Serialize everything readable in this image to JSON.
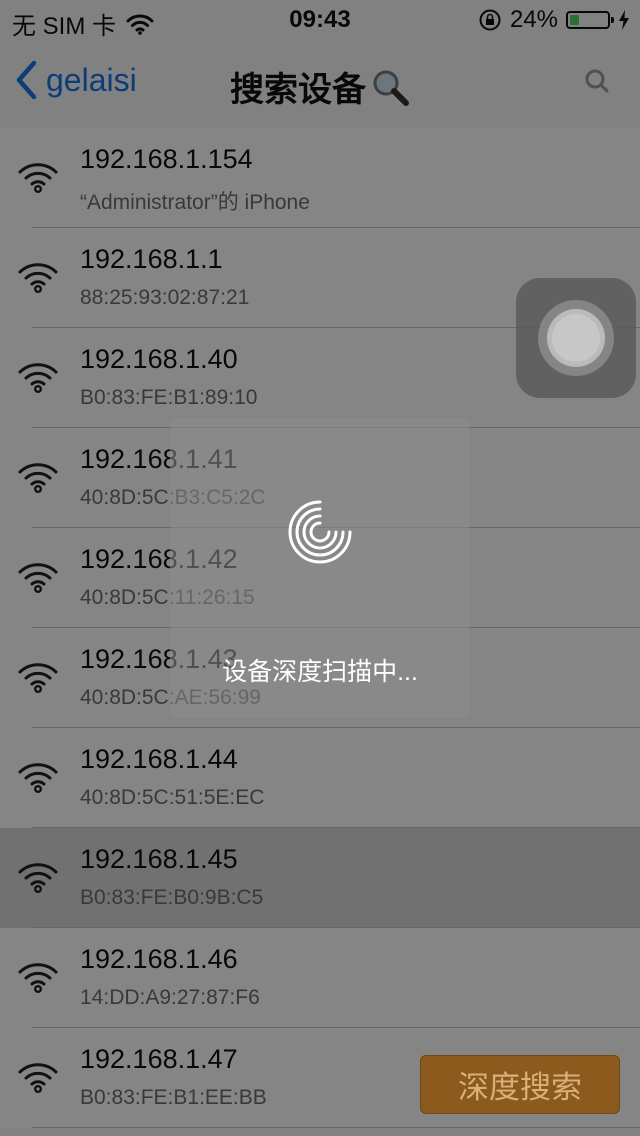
{
  "status_bar": {
    "carrier": "无 SIM 卡",
    "time": "09:43",
    "battery": "24%",
    "battery_level": 0.24
  },
  "nav": {
    "back_label": "gelaisi",
    "title": "搜索设备"
  },
  "devices": [
    {
      "ip": "192.168.1.154",
      "detail": "“Administrator”的 iPhone"
    },
    {
      "ip": "192.168.1.1",
      "detail": "88:25:93:02:87:21"
    },
    {
      "ip": "192.168.1.40",
      "detail": "B0:83:FE:B1:89:10"
    },
    {
      "ip": "192.168.1.41",
      "detail": "40:8D:5C:B3:C5:2C"
    },
    {
      "ip": "192.168.1.42",
      "detail": "40:8D:5C:11:26:15"
    },
    {
      "ip": "192.168.1.43",
      "detail": "40:8D:5C:AE:56:99"
    },
    {
      "ip": "192.168.1.44",
      "detail": "40:8D:5C:51:5E:EC"
    },
    {
      "ip": "192.168.1.45",
      "detail": "B0:83:FE:B0:9B:C5"
    },
    {
      "ip": "192.168.1.46",
      "detail": "14:DD:A9:27:87:F6"
    },
    {
      "ip": "192.168.1.47",
      "detail": "B0:83:FE:B1:EE:BB"
    }
  ],
  "selected_index": 7,
  "hud": {
    "text": "设备深度扫描中..."
  },
  "deep_search_button": "深度搜索",
  "colors": {
    "accent": "#1a73e8",
    "deep_button": "#8b5a1c",
    "battery": "#4cd964"
  }
}
